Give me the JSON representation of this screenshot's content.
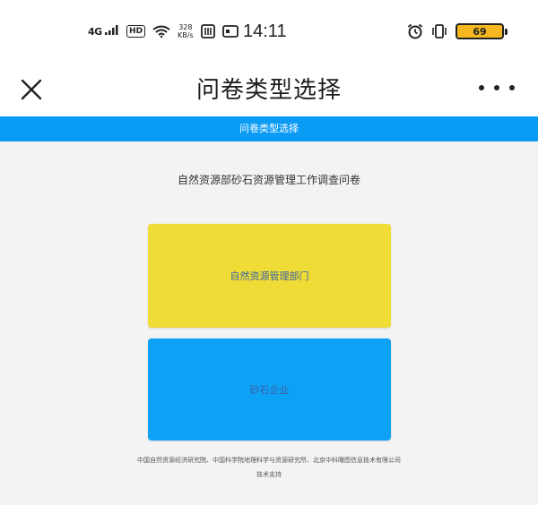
{
  "status_bar": {
    "network": "4G",
    "hd_label": "HD",
    "speed_value": "328",
    "speed_unit": "KB/s",
    "time": "14:11",
    "battery": "69"
  },
  "title_bar": {
    "title": "问卷类型选择"
  },
  "header": {
    "label": "问卷类型选择"
  },
  "main": {
    "survey_title": "自然资源部砂石资源管理工作调查问卷",
    "options": [
      {
        "label": "自然资源管理部门",
        "color": "#efdc37"
      },
      {
        "label": "砂石企业",
        "color": "#0ea2f6"
      }
    ]
  },
  "footer": {
    "orgs": "中国自然资源经济研究院、中国科学院地理科学与资源研究所、北京中科曙图信息技术有限公司",
    "support": "技术支持"
  },
  "colors": {
    "header_blue": "#0a9bf5",
    "option_text": "#3a63a8"
  }
}
